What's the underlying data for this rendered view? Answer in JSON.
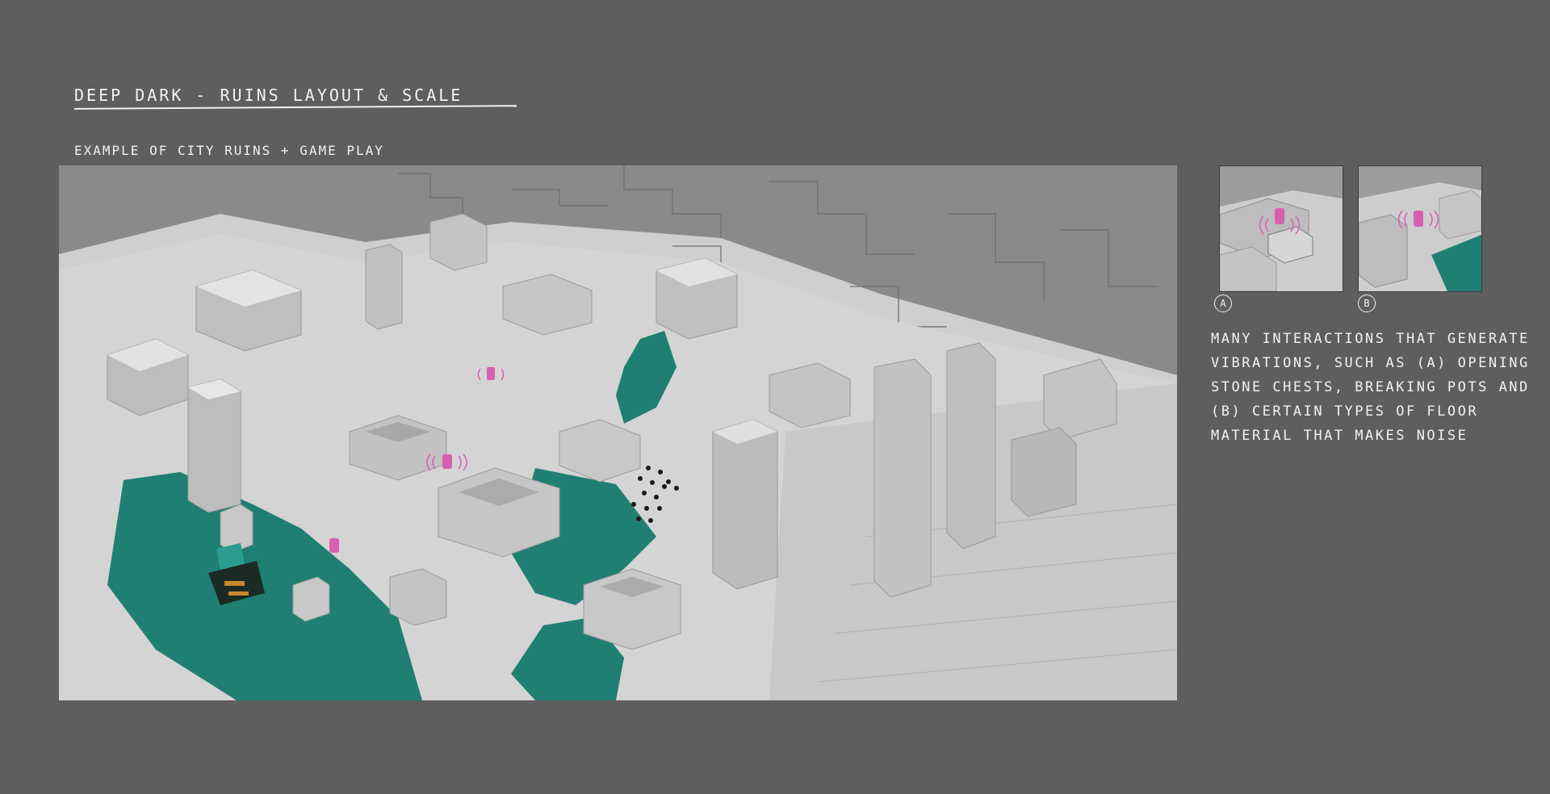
{
  "page": {
    "title": "DEEP DARK - RUINS LAYOUT & SCALE",
    "subtitle": "EXAMPLE OF CITY RUINS + GAME PLAY"
  },
  "thumbnails": [
    {
      "label": "A"
    },
    {
      "label": "B"
    }
  ],
  "note": "MANY INTERACTIONS THAT GENERATE VIBRATIONS, SUCH AS (A) OPENING STONE CHESTS, BREAKING POTS AND (B) CERTAIN TYPES OF FLOOR MATERIAL THAT MAKES NOISE",
  "colors": {
    "background": "#5e5e5e",
    "stone": "#cfcfcf",
    "sculk": "#1f7f72",
    "vibration": "#d85fb0"
  }
}
